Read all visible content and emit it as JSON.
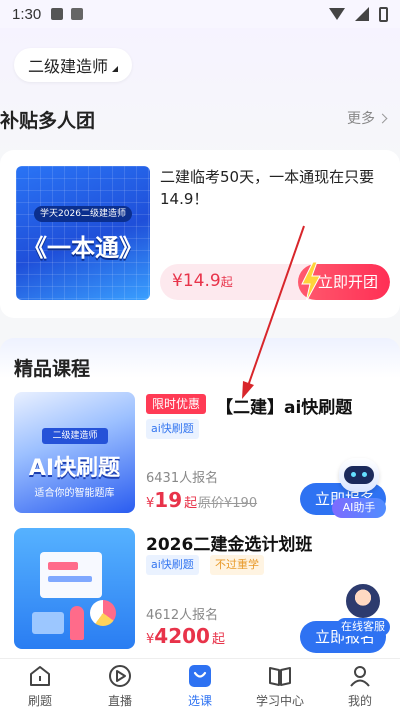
{
  "status_bar": {
    "time": "1:30"
  },
  "exam_selector": {
    "label": "二级建造师"
  },
  "group_buy": {
    "section_title": "补贴多人团",
    "more_label": "更多",
    "cover_subtitle": "学天2026二级建造师",
    "cover_title": "《一本通》",
    "title": "二建临考50天，一本通现在只要14.9！",
    "price_symbol": "¥",
    "price": "14.9",
    "price_suffix": "起",
    "join_label": "立即开团"
  },
  "courses_section": {
    "title": "精品课程",
    "courses": [
      {
        "badge": "限时优惠",
        "name": "【二建】ai快刷题",
        "tags": [
          "ai快刷题"
        ],
        "enroll_text": "6431人报名",
        "price_symbol": "¥",
        "price": "19",
        "price_suffix": "起",
        "original_price": "原价¥190",
        "signup_label": "立即报名",
        "cover_tag": "二级建造师",
        "cover_title": "AI快刷题",
        "cover_foot": "适合你的智能题库"
      },
      {
        "name": "2026二建金选计划班",
        "tags": [
          "ai快刷题",
          "不过重学"
        ],
        "enroll_text": "4612人报名",
        "price_symbol": "¥",
        "price": "4200",
        "price_suffix": "起",
        "signup_label": "立即报名"
      }
    ]
  },
  "floating": {
    "ai_assistant_label": "AI助手",
    "customer_service_label": "在线客服"
  },
  "tabbar": {
    "active_index": 2,
    "items": [
      {
        "label": "刷题",
        "icon": "home-icon"
      },
      {
        "label": "直播",
        "icon": "play-icon"
      },
      {
        "label": "选课",
        "icon": "course-icon"
      },
      {
        "label": "学习中心",
        "icon": "book-icon"
      },
      {
        "label": "我的",
        "icon": "user-icon"
      }
    ]
  },
  "colors": {
    "accent_blue": "#2e72f2",
    "price_red": "#e8334a",
    "annotation_red": "#d8262b"
  }
}
